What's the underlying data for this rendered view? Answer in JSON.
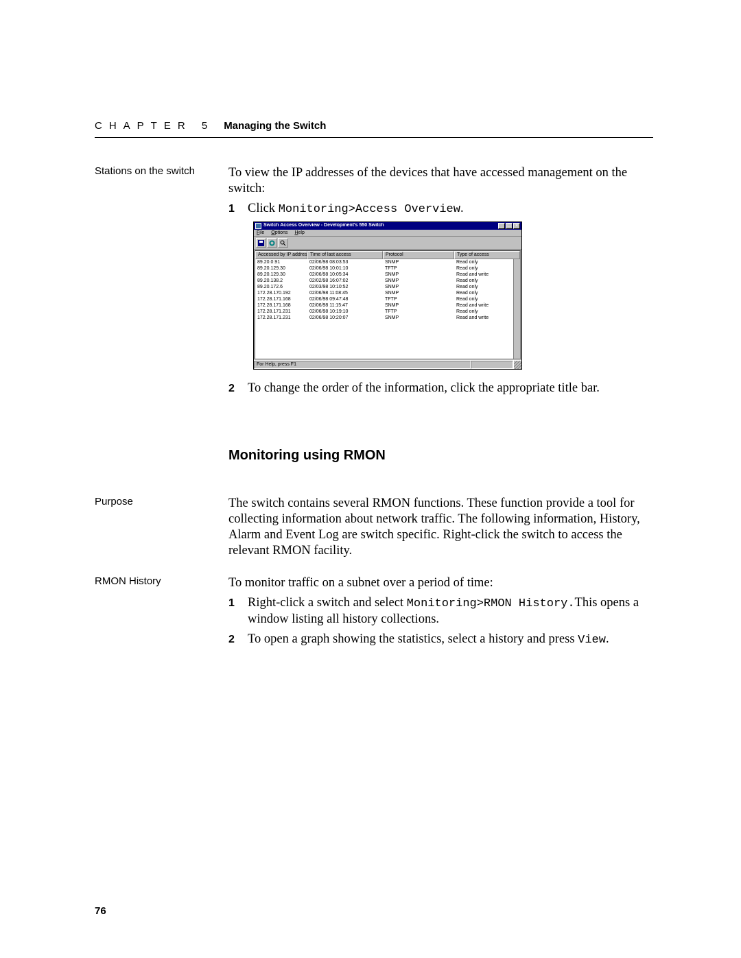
{
  "header": {
    "chapter_label": "CHAPTER 5",
    "chapter_title": "Managing the Switch"
  },
  "section_stations": {
    "side_label": "Stations on the switch",
    "intro": "To view the IP addresses of the devices that have accessed management on the switch:",
    "step1_prefix": "Click ",
    "step1_mono": "Monitoring>Access Overview",
    "step1_suffix": ".",
    "step2": "To change the order of the information, click the appropriate title bar."
  },
  "heading_rmon": "Monitoring using RMON",
  "section_purpose": {
    "side_label": "Purpose",
    "body": "The switch contains several RMON functions. These function provide a tool for collecting information about network traffic. The following information, History, Alarm and Event Log are switch specific. Right-click the switch to access the relevant RMON facility."
  },
  "section_history": {
    "side_label": "RMON History",
    "intro": "To monitor traffic on a subnet over a period of time:",
    "step1_a": "Right-click a switch and select ",
    "step1_mono": "Monitoring>RMON History.",
    "step1_b": "This opens a window listing all history collections.",
    "step2_a": "To open a graph showing the statistics, select a history and press ",
    "step2_mono": "View",
    "step2_b": "."
  },
  "page_number": "76",
  "app": {
    "title": "Switch Access Overview - Development's 550 Switch",
    "menus": [
      "File",
      "Options",
      "Help"
    ],
    "columns": {
      "ip": "Accessed by IP address",
      "time": "Time of last access",
      "proto": "Protocol",
      "access": "Type of access"
    },
    "rows": [
      {
        "ip": "89.20.0.91",
        "time": "02/06/98 08:03:53",
        "proto": "SNMP",
        "access": "Read only"
      },
      {
        "ip": "89.20.129.30",
        "time": "02/06/98 10:01:10",
        "proto": "TFTP",
        "access": "Read only"
      },
      {
        "ip": "89.20.129.30",
        "time": "02/06/98 10:05:34",
        "proto": "SNMP",
        "access": "Read and write"
      },
      {
        "ip": "89.20.138.2",
        "time": "02/02/98 16:07:02",
        "proto": "SNMP",
        "access": "Read only"
      },
      {
        "ip": "89.20.172.6",
        "time": "02/03/98 10:10:52",
        "proto": "SNMP",
        "access": "Read only"
      },
      {
        "ip": "172.28.170.192",
        "time": "02/06/98 11:08:45",
        "proto": "SNMP",
        "access": "Read only"
      },
      {
        "ip": "172.28.171.168",
        "time": "02/06/98 09:47:48",
        "proto": "TFTP",
        "access": "Read only"
      },
      {
        "ip": "172.28.171.168",
        "time": "02/06/98 11:15:47",
        "proto": "SNMP",
        "access": "Read and write"
      },
      {
        "ip": "172.28.171.231",
        "time": "02/06/98 10:19:10",
        "proto": "TFTP",
        "access": "Read only"
      },
      {
        "ip": "172.28.171.231",
        "time": "02/06/98 10:20:07",
        "proto": "SNMP",
        "access": "Read and write"
      }
    ],
    "status": "For Help, press F1"
  }
}
